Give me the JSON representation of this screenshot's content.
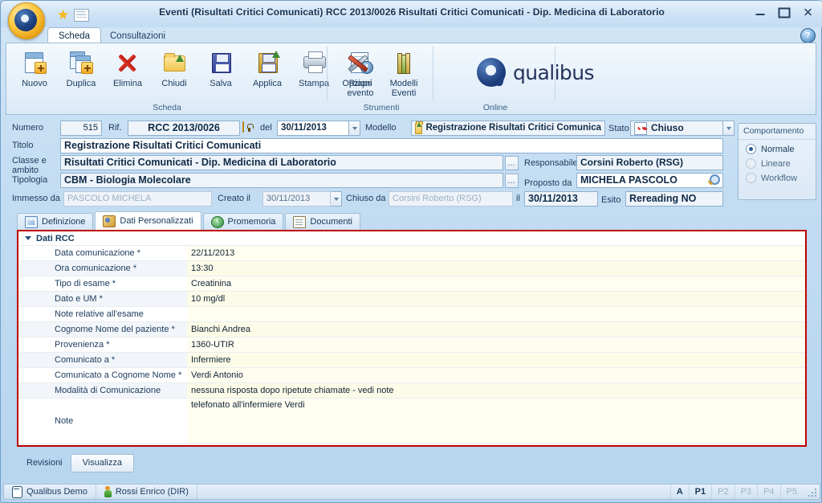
{
  "window": {
    "title": "Eventi (Risultati Critici Comunicati)  RCC 2013/0026 Risultati Critici Comunicati - Dip. Medicina di Laboratorio",
    "minimize_label": "–",
    "maximize_label": "",
    "close_label": "✕",
    "help_label": "?"
  },
  "quick_access": {
    "favorites_icon": "star-icon",
    "mail_icon": "envelope-icon"
  },
  "ribbon": {
    "tabs": [
      {
        "label": "Scheda",
        "active": true
      },
      {
        "label": "Consultazioni",
        "active": false
      }
    ],
    "groups": [
      {
        "name": "Scheda",
        "items": [
          {
            "label": "Nuovo",
            "icon": "new-document-icon"
          },
          {
            "label": "Duplica",
            "icon": "duplicate-icon"
          },
          {
            "label": "Elimina",
            "icon": "delete-x-icon"
          },
          {
            "label": "Chiudi",
            "icon": "close-folder-icon"
          },
          {
            "label": "Salva",
            "icon": "save-disk-icon"
          },
          {
            "label": "Applica",
            "icon": "apply-folder-icon"
          },
          {
            "label": "Stampa",
            "icon": "printer-icon"
          },
          {
            "label": "Riapri evento",
            "icon": "reopen-event-icon"
          }
        ]
      },
      {
        "name": "Strumenti",
        "items": [
          {
            "label": "Opzioni",
            "icon": "tools-icon"
          },
          {
            "label": "Modelli Eventi",
            "icon": "books-icon"
          }
        ]
      },
      {
        "name": "Online",
        "items": [
          {
            "label": "qualibus",
            "icon": "qualibus-logo"
          }
        ]
      }
    ]
  },
  "header_form": {
    "numero_label": "Numero",
    "numero_value": "515",
    "rif_label": "Rif.",
    "rif_value": "RCC 2013/0026",
    "lock_icon": "lock-icon",
    "del_label": "del",
    "del_value": "30/11/2013",
    "modello_label": "Modello",
    "modello_icon": "folder-icon",
    "modello_value": "Registrazione Risultati Critici Comunica",
    "stato_label": "Stato",
    "stato_icon": "checked-box-icon",
    "stato_value": "Chiuso",
    "titolo_label": "Titolo",
    "titolo_value": "Registrazione Risultati Critici Comunicati",
    "classe_label_l1": "Classe e",
    "classe_label_l2": "ambito",
    "classe_value": "Risultati Critici Comunicati - Dip. Medicina di Laboratorio",
    "tipologia_label": "Tipologia",
    "tipologia_value": "CBM - Biologia Molecolare",
    "ellipsis_label": "…",
    "responsabile_label": "Responsabile",
    "responsabile_value": "Corsini Roberto (RSG)",
    "proposto_label": "Proposto da",
    "proposto_value": "MICHELA PASCOLO",
    "proposto_icon": "magnifier-icon",
    "immesso_label": "Immesso da",
    "immesso_value": "PASCOLO MICHELA",
    "creato_label": "Creato il",
    "creato_value": "30/11/2013",
    "chiuso_da_label": "Chiuso da",
    "chiuso_da_value": "Corsini Roberto (RSG)",
    "il_label": "il",
    "il_value": "30/11/2013",
    "esito_label": "Esito",
    "esito_value": "Rereading NO"
  },
  "behavior_panel": {
    "title": "Comportamento",
    "options": [
      {
        "label": "Normale",
        "selected": true
      },
      {
        "label": "Lineare",
        "selected": false
      },
      {
        "label": "Workflow",
        "selected": false
      }
    ]
  },
  "content_tabs": [
    {
      "label": "Definizione",
      "icon": "definition-icon",
      "active": false
    },
    {
      "label": "Dati Personalizzati",
      "icon": "custom-data-icon",
      "active": true
    },
    {
      "label": "Promemoria",
      "icon": "reminder-icon",
      "active": false
    },
    {
      "label": "Documenti",
      "icon": "documents-icon",
      "active": false
    }
  ],
  "grid": {
    "section_title": "Dati RCC",
    "collapse_icon": "chevron-down-icon",
    "rows": [
      {
        "label": "Data comunicazione *",
        "value": "22/11/2013"
      },
      {
        "label": "Ora comunicazione *",
        "value": "13:30"
      },
      {
        "label": "Tipo di esame *",
        "value": "Creatinina"
      },
      {
        "label": "Dato e UM *",
        "value": "10 mg/dl"
      },
      {
        "label": "Note relative all'esame",
        "value": ""
      },
      {
        "label": "Cognome Nome del paziente *",
        "value": "Bianchi Andrea"
      },
      {
        "label": "Provenienza *",
        "value": "1360-UTIR"
      },
      {
        "label": "Comunicato a *",
        "value": "Infermiere"
      },
      {
        "label": "Comunicato a Cognome Nome *",
        "value": "Verdi Antonio"
      },
      {
        "label": "Modalità di Comunicazione",
        "value": "nessuna risposta dopo ripetute chiamate - vedi note"
      }
    ],
    "note_row": {
      "label": "Note",
      "value": "telefonato all'infermiere Verdi"
    }
  },
  "revisions": {
    "label": "Revisioni",
    "button_label": "Visualizza"
  },
  "status_bar": {
    "database": "Qualibus Demo",
    "database_icon": "database-icon",
    "user": "Rossi Enrico (DIR)",
    "user_icon": "user-icon",
    "indicators": [
      {
        "label": "A",
        "active": true
      },
      {
        "label": "P1",
        "active": true
      },
      {
        "label": "P2",
        "active": false
      },
      {
        "label": "P3",
        "active": false
      },
      {
        "label": "P4",
        "active": false
      },
      {
        "label": "P5",
        "active": false
      }
    ],
    "resize_grip_icon": "resize-grip-icon"
  },
  "colors": {
    "accent_border_red": "#c00000",
    "window_chrome": "#c2dcf2",
    "grid_value_bg": "#fffef0",
    "brand_gold": "#f0a92a"
  }
}
